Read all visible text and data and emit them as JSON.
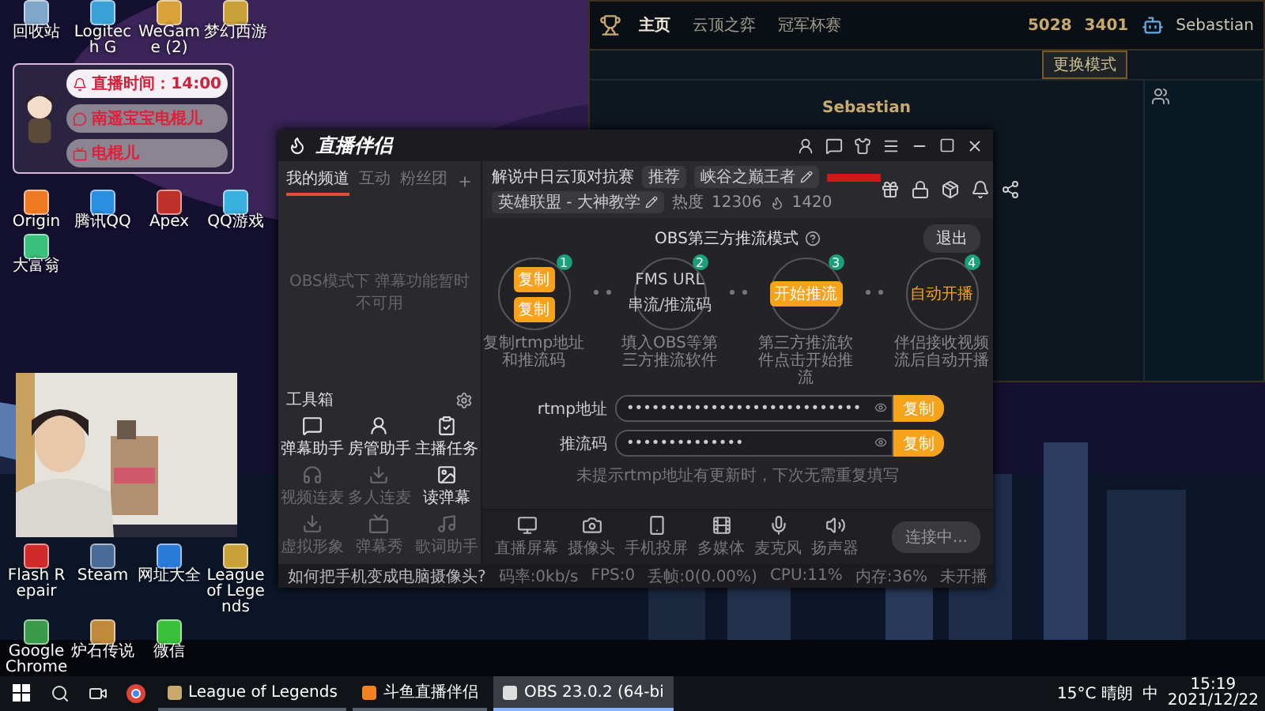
{
  "desktop": {
    "top_icons": [
      {
        "label": "回收站",
        "color": "#7fa7c9"
      },
      {
        "label": "Logitech G",
        "color": "#3aa0d8"
      },
      {
        "label": "WeGame (2)",
        "color": "#d8a23a"
      },
      {
        "label": "梦幻西游",
        "color": "#c9a03a"
      }
    ],
    "middle_icons": [
      {
        "label": "Origin",
        "color": "#f07a24"
      },
      {
        "label": "腾讯QQ",
        "color": "#2a8fe0"
      },
      {
        "label": "Apex",
        "color": "#c0302a"
      },
      {
        "label": "QQ游戏",
        "color": "#3ab0e0"
      },
      {
        "label": "大富翁",
        "color": "#3ac07a"
      }
    ],
    "bottom_icons": [
      {
        "label": "Flash Repair",
        "color": "#d02a2a"
      },
      {
        "label": "Steam",
        "color": "#4a6a9a"
      },
      {
        "label": "网址大全",
        "color": "#2a7ad8"
      },
      {
        "label": "League of Legends",
        "color": "#c9a03a"
      },
      {
        "label": "Google Chrome",
        "color": "#3a9a4a"
      },
      {
        "label": "炉石传说",
        "color": "#c08a3a"
      },
      {
        "label": "微信",
        "color": "#3ac03a"
      }
    ]
  },
  "overlay": {
    "lines": [
      {
        "text": "直播时间：14:00",
        "kind": "time"
      },
      {
        "text": "南遥宝宝电棍儿",
        "kind": "weibo"
      },
      {
        "text": "电棍儿",
        "kind": "douyu"
      }
    ]
  },
  "game_client": {
    "nav": [
      {
        "label": "主页",
        "selected": true
      },
      {
        "label": "云顶之弈",
        "selected": false
      },
      {
        "label": "冠军杯赛",
        "selected": false
      }
    ],
    "currency": [
      "5028",
      "3401"
    ],
    "player": "Sebastian",
    "lobby_player": "Sebastian",
    "mode_button": "更换模式"
  },
  "app": {
    "title": "直播伴侣",
    "side_tabs": [
      {
        "label": "我的频道",
        "selected": true
      },
      {
        "label": "互动",
        "selected": false
      },
      {
        "label": "粉丝团",
        "selected": false
      }
    ],
    "side_notice": "OBS模式下 弹幕功能暂时不可用",
    "toolbox_title": "工具箱",
    "tools": [
      {
        "label": "弹幕助手",
        "disabled": false
      },
      {
        "label": "房管助手",
        "disabled": false
      },
      {
        "label": "主播任务",
        "disabled": false
      },
      {
        "label": "视频连麦",
        "disabled": true
      },
      {
        "label": "多人连麦",
        "disabled": true
      },
      {
        "label": "读弹幕",
        "disabled": false
      },
      {
        "label": "虚拟形象",
        "disabled": true
      },
      {
        "label": "弹幕秀",
        "disabled": true
      },
      {
        "label": "歌词助手",
        "disabled": true
      }
    ],
    "stream_title": "解说中日云顶对抗赛",
    "tag": "推荐",
    "room_name": "峡谷之巅王者",
    "category": "英雄联盟 - 大神教学",
    "heat_label": "热度",
    "heat": "12306",
    "fans": "1420",
    "mode_title": "OBS第三方推流模式",
    "exit_button": "退出",
    "steps": [
      {
        "number": "1",
        "kind": "copy",
        "items": [
          "复制",
          "复制"
        ],
        "caption": "复制rtmp地址和推流码"
      },
      {
        "number": "2",
        "kind": "fields",
        "items": [
          "FMS URL",
          "串流/推流码"
        ],
        "caption": "填入OBS等第三方推流软件"
      },
      {
        "number": "3",
        "kind": "button",
        "items": [
          "开始推流"
        ],
        "caption": "第三方推流软件点击开始推流"
      },
      {
        "number": "4",
        "kind": "text",
        "items": [
          "自动开播"
        ],
        "caption": "伴侣接收视频流后自动开播"
      }
    ],
    "fields": [
      {
        "label": "rtmp地址",
        "value": "••••••••••••••••••••••••••••",
        "button": "复制"
      },
      {
        "label": "推流码",
        "value": "••••••••••••••",
        "button": "复制"
      }
    ],
    "hint": "未提示rtmp地址有更新时，下次无需重复填写",
    "sources": [
      {
        "label": "直播屏幕",
        "kind": "screen"
      },
      {
        "label": "摄像头",
        "kind": "camera"
      },
      {
        "label": "手机投屏",
        "kind": "phone"
      },
      {
        "label": "多媒体",
        "kind": "media"
      },
      {
        "label": "麦克风",
        "kind": "mic"
      },
      {
        "label": "扬声器",
        "kind": "speaker"
      }
    ],
    "connect_button": "连接中...",
    "help_link": "如何把手机变成电脑摄像头?",
    "stats": [
      "码率:0kb/s",
      "FPS:0",
      "丢帧:0(0.00%)",
      "CPU:11%",
      "内存:36%",
      "未开播"
    ]
  },
  "taskbar": {
    "apps": [
      {
        "label": "League of Legends",
        "kind": "lol",
        "selected": false
      },
      {
        "label": "斗鱼直播伴侣",
        "kind": "douyu",
        "selected": false
      },
      {
        "label": "OBS 23.0.2 (64-bi",
        "kind": "obs",
        "selected": true
      }
    ],
    "weather": "15°C 晴朗",
    "ime": "中",
    "time": "15:19",
    "date": "2021/12/22"
  }
}
